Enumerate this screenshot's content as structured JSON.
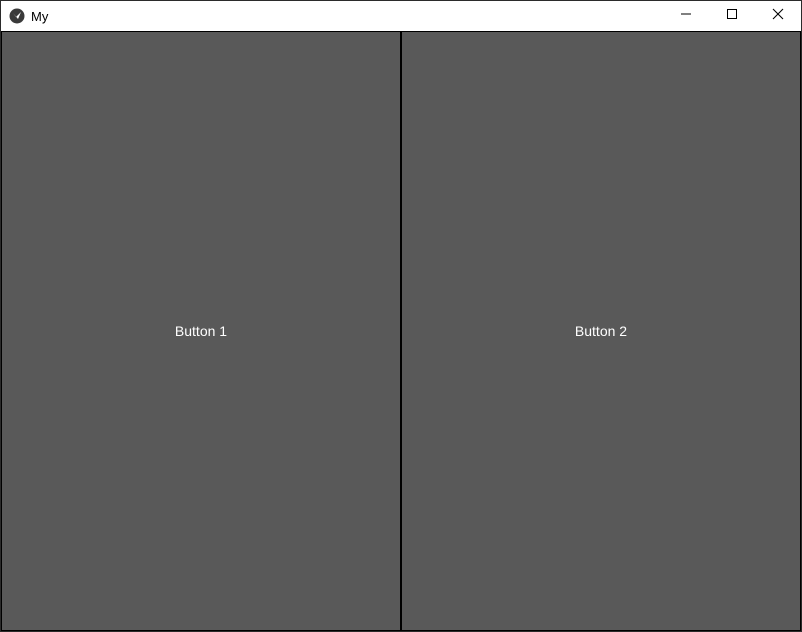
{
  "window": {
    "title": "My",
    "app_icon": "kivy-logo-icon",
    "controls": {
      "minimize_icon": "minimize-icon",
      "maximize_icon": "maximize-icon",
      "close_icon": "close-icon"
    }
  },
  "buttons": [
    {
      "label": "Button 1"
    },
    {
      "label": "Button 2"
    }
  ],
  "colors": {
    "titlebar_bg": "#ffffff",
    "button_bg": "#595959",
    "button_text": "#ffffff",
    "separator": "#000000"
  }
}
